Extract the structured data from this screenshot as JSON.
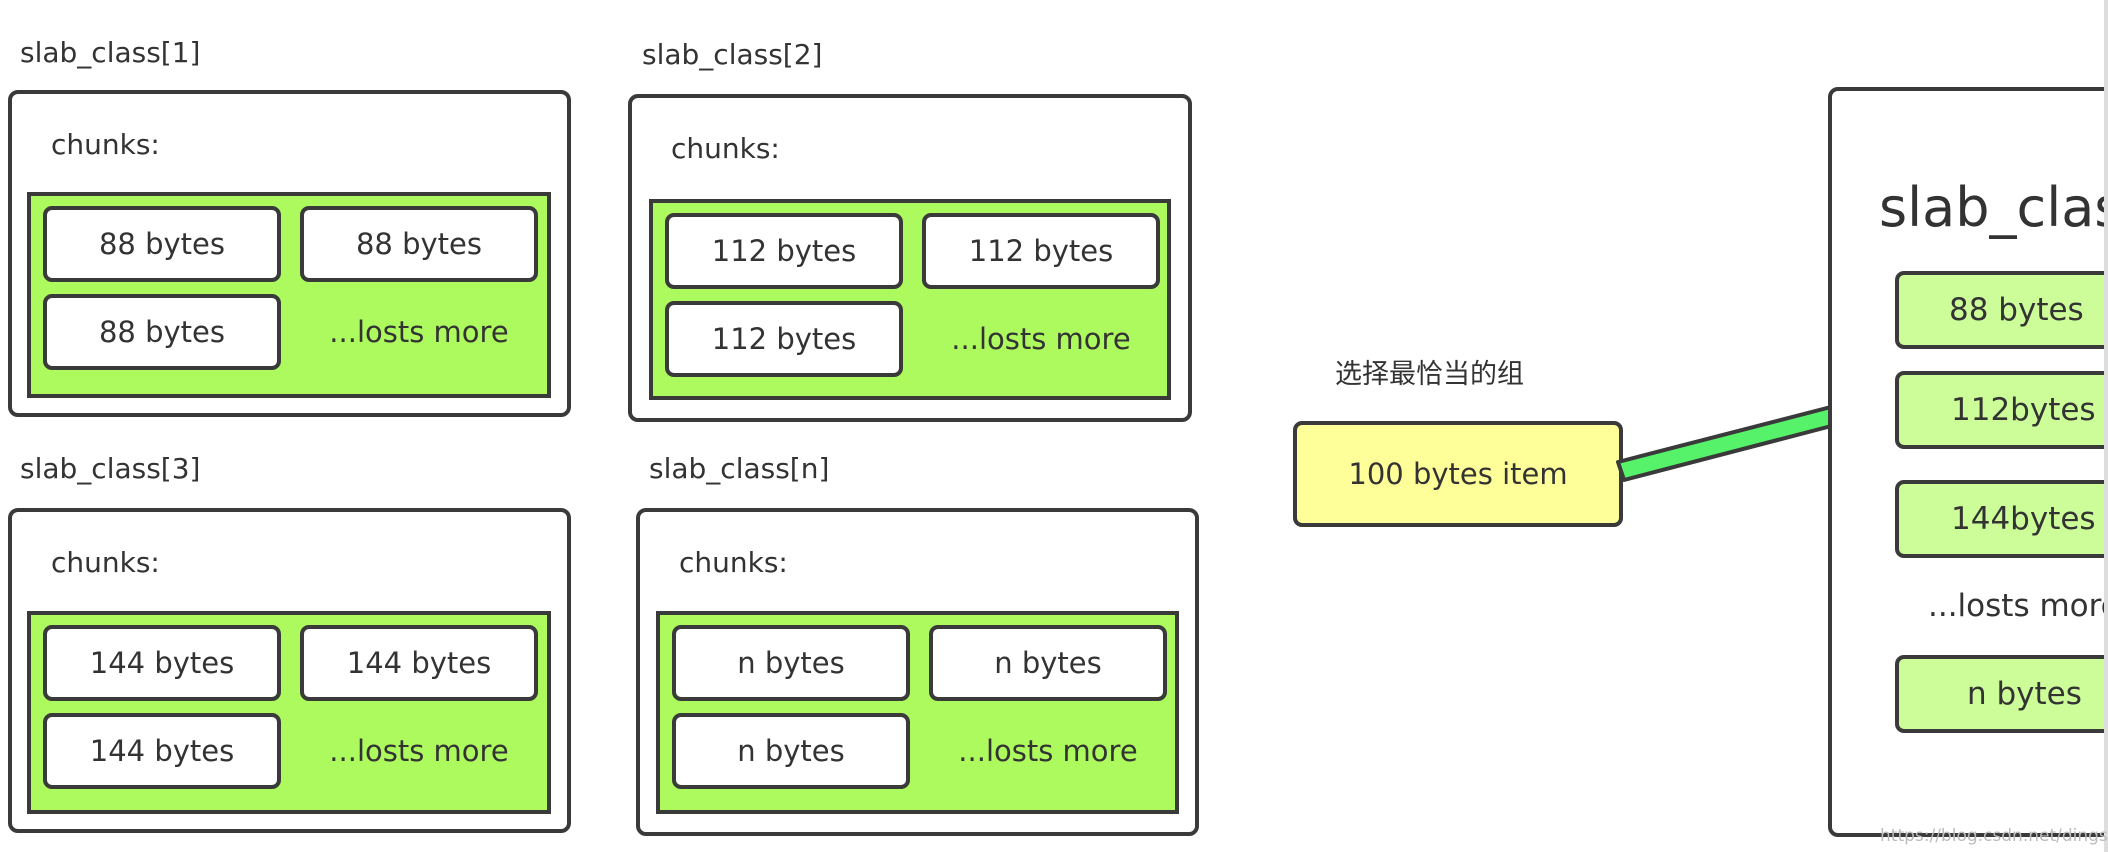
{
  "slab_classes": [
    {
      "title": "slab_class[1]",
      "chunks_label": "chunks:",
      "cells": [
        "88 bytes",
        "88 bytes",
        "88 bytes"
      ],
      "more": "...losts more"
    },
    {
      "title": "slab_class[2]",
      "chunks_label": "chunks:",
      "cells": [
        "112 bytes",
        "112 bytes",
        "112 bytes"
      ],
      "more": "...losts more"
    },
    {
      "title": "slab_class[3]",
      "chunks_label": "chunks:",
      "cells": [
        "144 bytes",
        "144 bytes",
        "144 bytes"
      ],
      "more": "...losts more"
    },
    {
      "title": "slab_class[n]",
      "chunks_label": "chunks:",
      "cells": [
        "n bytes",
        "n bytes",
        "n bytes"
      ],
      "more": "...losts more"
    }
  ],
  "selector": {
    "caption": "选择最恰当的组",
    "item": "100 bytes item"
  },
  "right_panel": {
    "title": "slab_class",
    "cells": [
      "88 bytes",
      "112bytes",
      "144bytes",
      "n bytes"
    ],
    "more": "...losts more"
  },
  "watermark": "https://blog.csdn.net/dingshgdf",
  "colors": {
    "chunk_area": "#adfa5f",
    "right_cell": "#ccfd99",
    "item": "#ffff99",
    "arrow": "#55f26a",
    "border": "#3a3a3a"
  }
}
